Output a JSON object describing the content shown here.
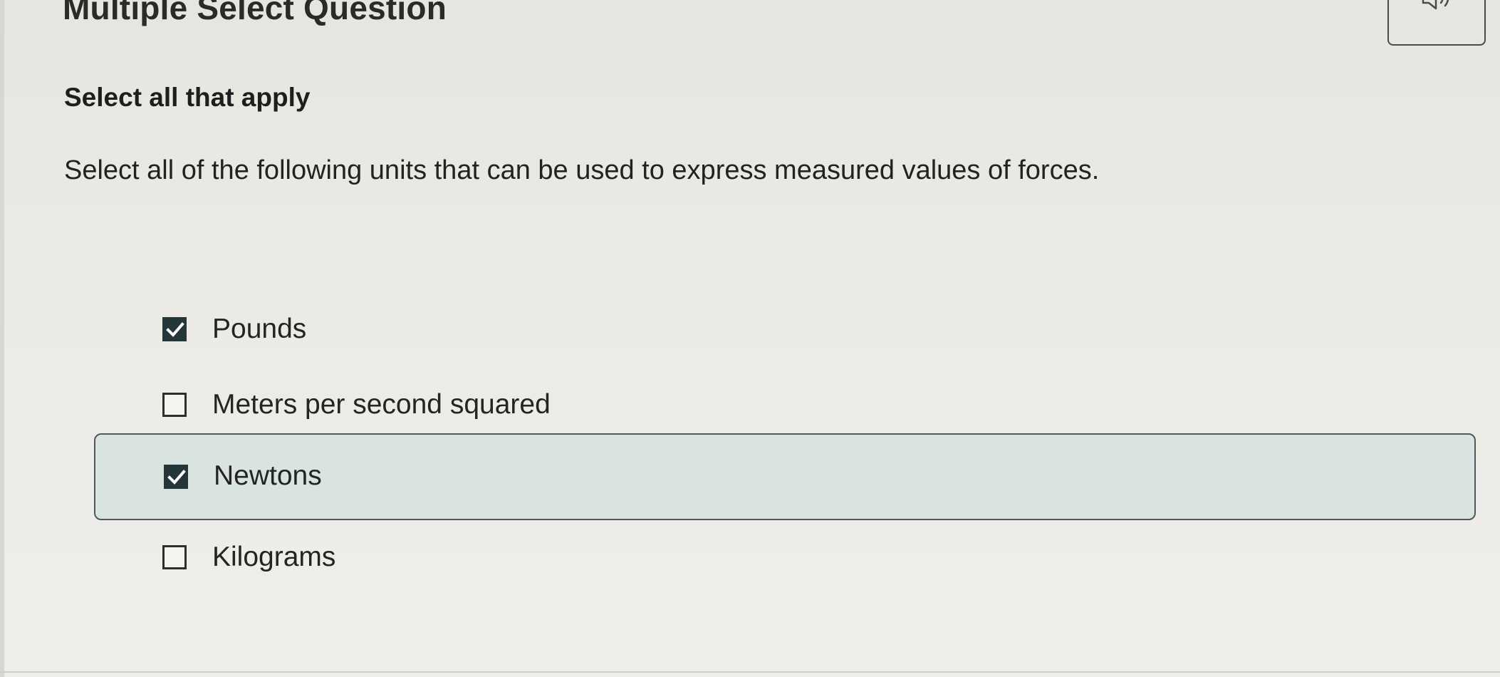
{
  "header": {
    "question_type": "Multiple Select Question",
    "audio_icon": "speaker-icon"
  },
  "question": {
    "instruction": "Select all that apply",
    "prompt": "Select all of the following units that can be used to express measured values of forces."
  },
  "options": [
    {
      "label": "Pounds",
      "checked": true,
      "focused": false
    },
    {
      "label": "Meters per second squared",
      "checked": false,
      "focused": false
    },
    {
      "label": "Newtons",
      "checked": true,
      "focused": true
    },
    {
      "label": "Kilograms",
      "checked": false,
      "focused": false
    }
  ],
  "colors": {
    "checked_fill": "#24363a",
    "focus_background": "#d9e4e0",
    "focus_border": "#4d5a59"
  }
}
